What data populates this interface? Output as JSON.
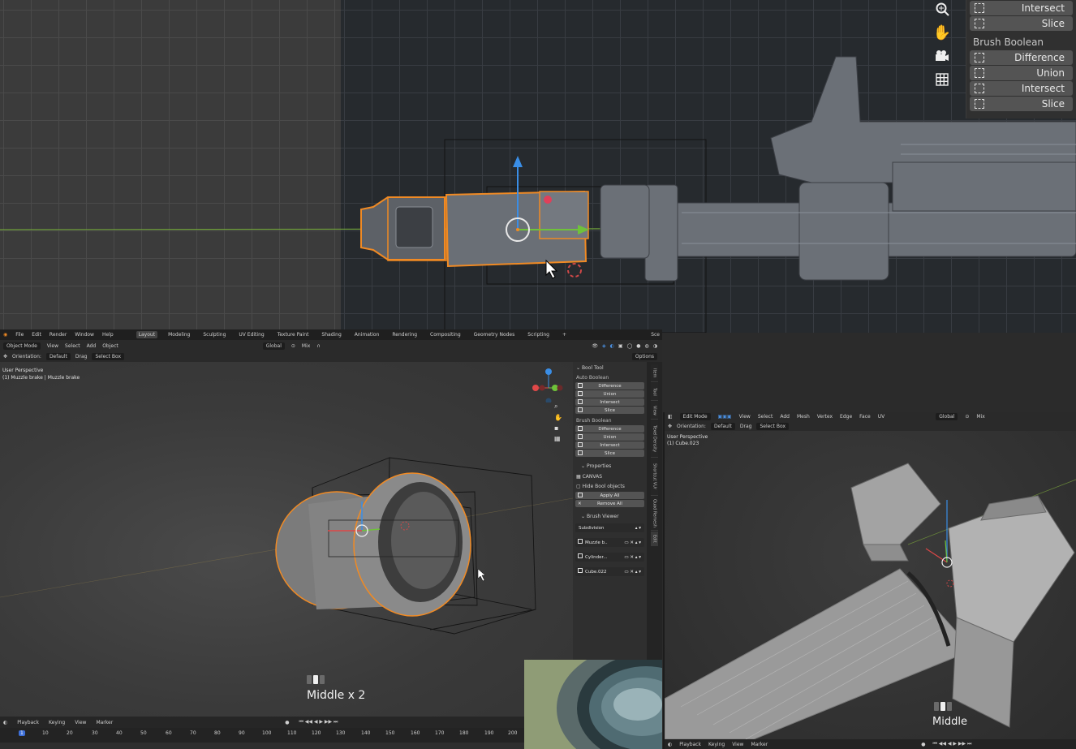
{
  "top_panel": {
    "auto_items": [
      "Intersect",
      "Slice"
    ],
    "brush_boolean_title": "Brush Boolean",
    "brush_items": [
      "Difference",
      "Union",
      "Intersect",
      "Slice"
    ]
  },
  "left_app": {
    "menus": [
      "File",
      "Edit",
      "Render",
      "Window",
      "Help"
    ],
    "workspaces": [
      "Layout",
      "Modeling",
      "Sculpting",
      "UV Editing",
      "Texture Paint",
      "Shading",
      "Animation",
      "Rendering",
      "Compositing",
      "Geometry Nodes",
      "Scripting",
      "+"
    ],
    "scene_label": "Sce",
    "mode": "Object Mode",
    "header_menus": [
      "View",
      "Select",
      "Add",
      "Object"
    ],
    "transform_orientation": "Global",
    "proportional": "Mix",
    "orientation_label": "Orientation:",
    "orientation_value": "Default",
    "drag_label": "Drag",
    "drag_value": "Select Box",
    "options_label": "Options",
    "viewport_info": [
      "User Perspective",
      "(1) Muzzle brake | Muzzle brake"
    ],
    "gizmo_axes": [
      "X",
      "Y",
      "Z"
    ],
    "bool_tool": {
      "title": "Bool Tool",
      "auto_title": "Auto Boolean",
      "auto_items": [
        "Difference",
        "Union",
        "Intersect",
        "Slice"
      ],
      "brush_title": "Brush Boolean",
      "brush_items": [
        "Difference",
        "Union",
        "Intersect",
        "Slice"
      ],
      "properties_title": "Properties",
      "canvas_label": "CANVAS",
      "hide_label": "Hide Bool objects",
      "apply_all": "Apply All",
      "remove_all": "Remove All",
      "viewer_title": "Brush Viewer",
      "modifier": "Subdivision",
      "brushes": [
        "Muzzle b..",
        "Cylinder...",
        "Cube.022"
      ]
    },
    "side_tabs": [
      "Item",
      "Tool",
      "View",
      "Texel Density",
      "Shortcut VUr",
      "Quad Remesh",
      "Edit"
    ],
    "key_hint": "Middle x 2",
    "timeline": {
      "menus": [
        "Playback",
        "Keying",
        "View",
        "Marker"
      ],
      "current_frame": "1",
      "frames": [
        "10",
        "20",
        "30",
        "40",
        "50",
        "60",
        "70",
        "80",
        "90",
        "100",
        "110",
        "120",
        "130",
        "140",
        "150",
        "160",
        "170",
        "180",
        "190",
        "200"
      ]
    }
  },
  "right_app": {
    "mode": "Edit Mode",
    "header_menus": [
      "View",
      "Select",
      "Add",
      "Mesh",
      "Vertex",
      "Edge",
      "Face",
      "UV"
    ],
    "transform_orientation": "Global",
    "proportional": "Mix",
    "orientation_label": "Orientation:",
    "orientation_value": "Default",
    "drag_label": "Drag",
    "drag_value": "Select Box",
    "viewport_info": [
      "User Perspective",
      "(1) Cube.023"
    ],
    "key_hint": "Middle",
    "timeline_menus": [
      "Playback",
      "Keying",
      "View",
      "Marker"
    ]
  }
}
